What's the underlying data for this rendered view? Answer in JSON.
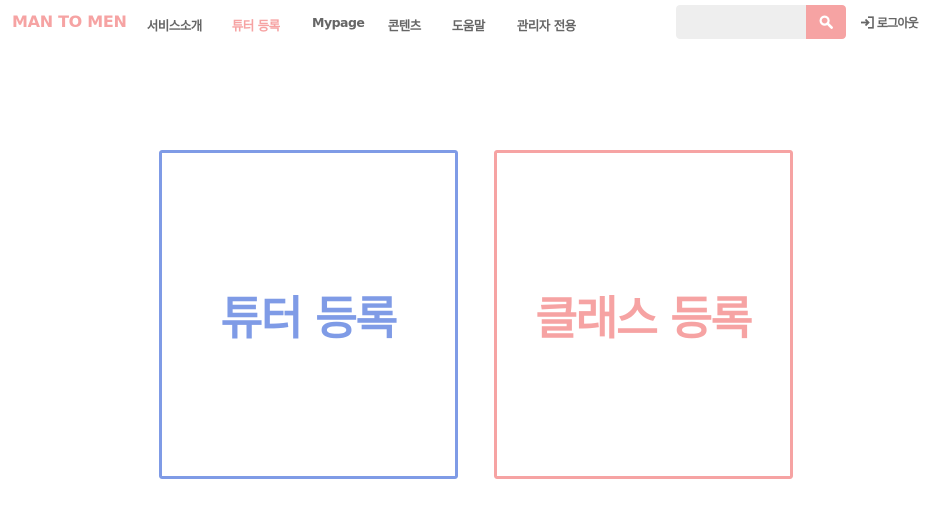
{
  "colors": {
    "brand": "#f6a3a3",
    "nav_text": "#666666",
    "nav_active": "#f6a3a3",
    "search_bg": "#eeeeee",
    "search_button": "#f6a3a3",
    "tutor_accent": "#7f9be6",
    "class_accent": "#f6a3a3"
  },
  "header": {
    "brand": "MAN TO MEN",
    "nav": [
      {
        "label": "서비스소개",
        "active": false
      },
      {
        "label": "튜터 등록",
        "active": true
      },
      {
        "label": "Mypage",
        "active": false
      },
      {
        "label": "콘텐츠",
        "active": false
      },
      {
        "label": "도움말",
        "active": false
      },
      {
        "label": "관리자 전용",
        "active": false
      }
    ],
    "search": {
      "placeholder": "",
      "value": "",
      "button_icon": "search-icon"
    },
    "logout": {
      "icon": "sign-in-icon",
      "label": "로그아웃"
    }
  },
  "main": {
    "cards": [
      {
        "label": "튜터 등록",
        "accent": "tutor"
      },
      {
        "label": "클래스 등록",
        "accent": "class"
      }
    ]
  }
}
